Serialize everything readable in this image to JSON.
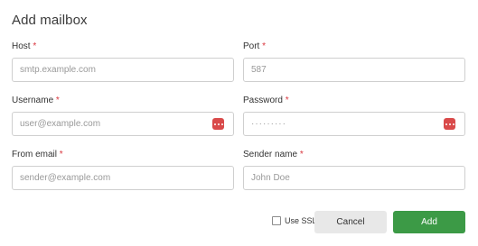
{
  "dialog": {
    "title": "Add mailbox"
  },
  "fields": {
    "host": {
      "label": "Host",
      "required_mark": "*",
      "placeholder": "smtp.example.com",
      "value": ""
    },
    "port": {
      "label": "Port",
      "required_mark": "*",
      "placeholder": "587",
      "value": ""
    },
    "username": {
      "label": "Username",
      "required_mark": "*",
      "placeholder": "user@example.com",
      "value": ""
    },
    "password": {
      "label": "Password",
      "required_mark": "*",
      "placeholder": "·········",
      "value": ""
    },
    "from_email": {
      "label": "From email",
      "required_mark": "*",
      "placeholder": "sender@example.com",
      "value": ""
    },
    "sender_name": {
      "label": "Sender name",
      "required_mark": "*",
      "placeholder": "John Doe",
      "value": ""
    }
  },
  "options": {
    "use_ssl_label": "Use SSL",
    "use_ssl_checked": false
  },
  "actions": {
    "cancel_label": "Cancel",
    "add_label": "Add"
  },
  "colors": {
    "primary": "#3c9a46",
    "required": "#d9363e",
    "password_manager_icon": "#d94a4a"
  },
  "icons": {
    "password_manager": "password-manager-key-icon"
  }
}
